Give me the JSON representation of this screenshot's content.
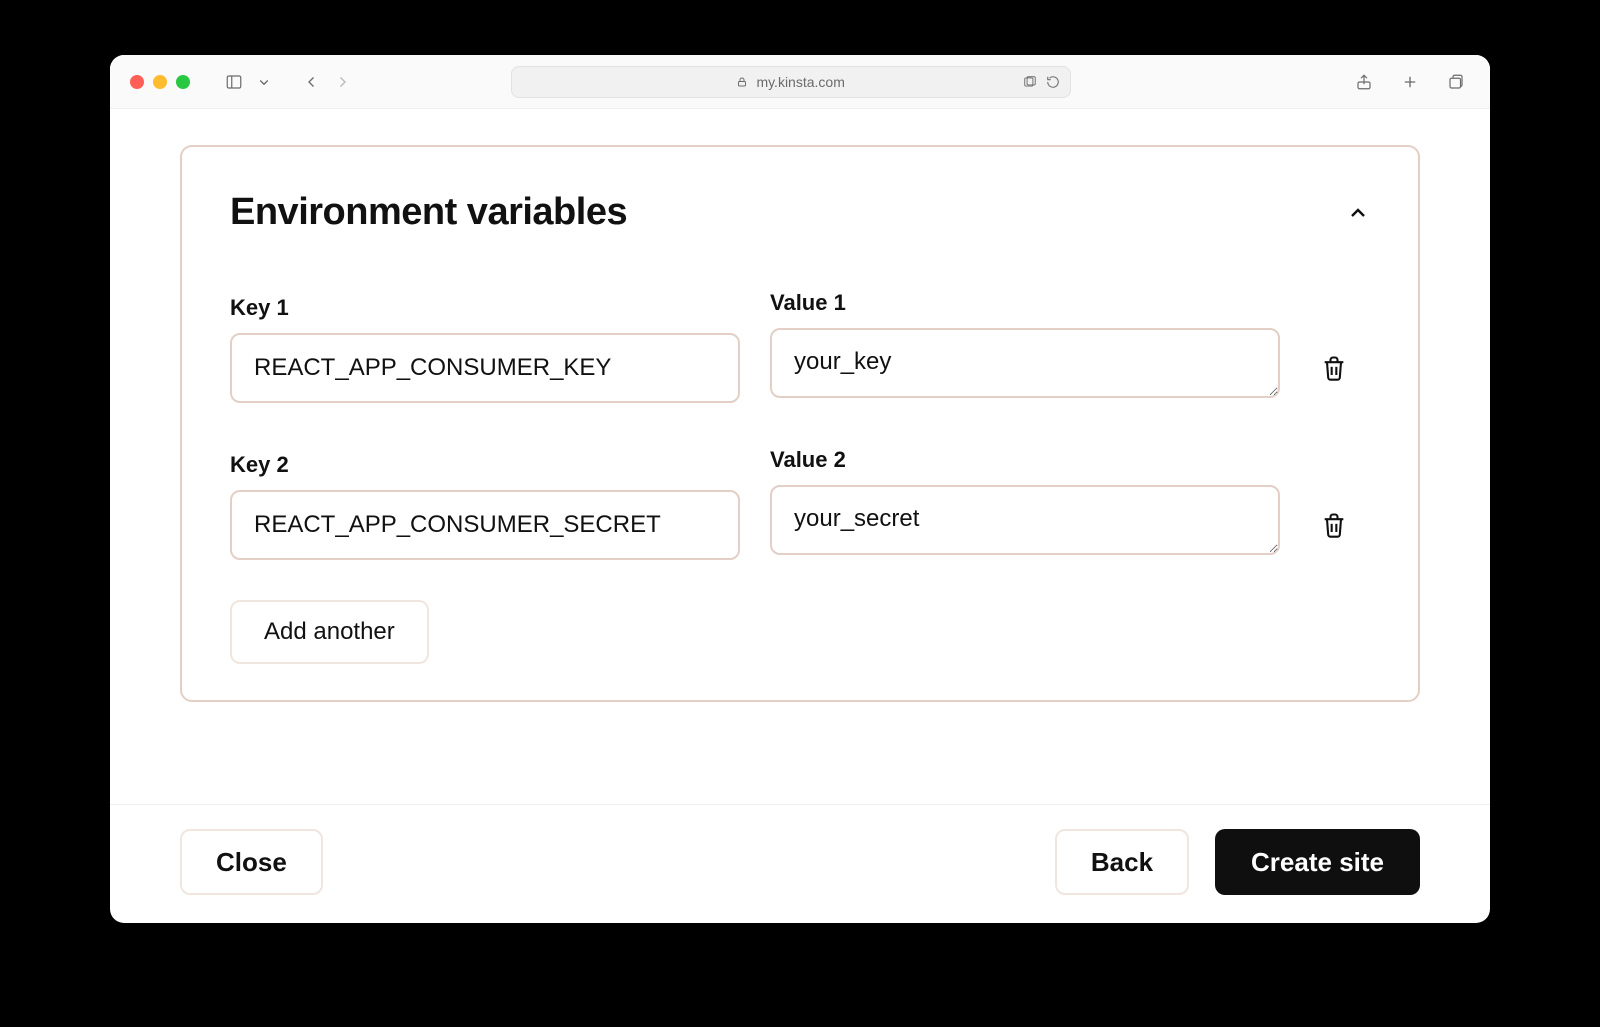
{
  "browser": {
    "address": "my.kinsta.com"
  },
  "panel": {
    "title": "Environment variables",
    "rows": [
      {
        "key_label": "Key 1",
        "key_value": "REACT_APP_CONSUMER_KEY",
        "value_label": "Value 1",
        "value_value": "your_key"
      },
      {
        "key_label": "Key 2",
        "key_value": "REACT_APP_CONSUMER_SECRET",
        "value_label": "Value 2",
        "value_value": "your_secret"
      }
    ],
    "add_another_label": "Add another"
  },
  "footer": {
    "close_label": "Close",
    "back_label": "Back",
    "create_label": "Create site"
  }
}
